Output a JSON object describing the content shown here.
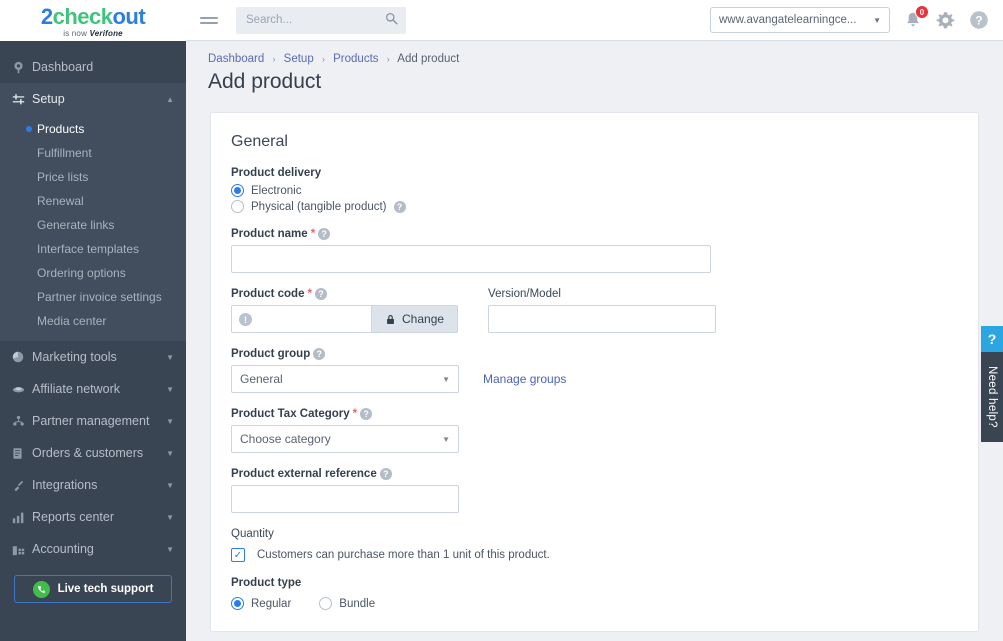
{
  "brand": {
    "logo_part1": "2",
    "logo_part2": "check",
    "logo_part3": "out",
    "tagline_pre": "is now ",
    "tagline_brand": "Verifone",
    "accent_blue": "#2b7de9",
    "accent_green": "#3fc47c",
    "sidebar_bg": "#3a4553"
  },
  "topbar": {
    "menu_icon": "hamburger-icon",
    "search": {
      "value": "",
      "placeholder": "Search..."
    },
    "site_selector": {
      "value": "www.avangatelearningce...",
      "caret": "▼"
    },
    "notifications": {
      "icon": "bell-icon",
      "badge": "0"
    },
    "settings": {
      "icon": "gear-icon"
    },
    "help": {
      "icon": "question-circle-icon"
    }
  },
  "breadcrumb": {
    "items": [
      "Dashboard",
      "Setup",
      "Products",
      "Add product"
    ],
    "separator": "›"
  },
  "page": {
    "title": "Add product"
  },
  "sidebar": {
    "items": [
      {
        "label": "Dashboard",
        "icon": "dashboard-icon",
        "glyph": "◑",
        "expandable": false
      },
      {
        "label": "Setup",
        "icon": "setup-sliders-icon",
        "glyph": "≡",
        "expandable": true,
        "expanded": true,
        "caret": "▲"
      },
      {
        "label": "Marketing tools",
        "icon": "marketing-pie-icon",
        "glyph": "◔",
        "expandable": true,
        "caret": "▼"
      },
      {
        "label": "Affiliate network",
        "icon": "affiliate-icon",
        "glyph": "▬",
        "expandable": true,
        "caret": "▼"
      },
      {
        "label": "Partner management",
        "icon": "partner-people-icon",
        "glyph": "⚘",
        "expandable": true,
        "caret": "▼"
      },
      {
        "label": "Orders & customers",
        "icon": "orders-clipboard-icon",
        "glyph": "☰",
        "expandable": true,
        "caret": "▼"
      },
      {
        "label": "Integrations",
        "icon": "integrations-plug-icon",
        "glyph": "✂",
        "expandable": true,
        "caret": "▼"
      },
      {
        "label": "Reports center",
        "icon": "reports-bars-icon",
        "glyph": "█",
        "expandable": true,
        "caret": "▼"
      },
      {
        "label": "Accounting",
        "icon": "accounting-icon",
        "glyph": "▓",
        "expandable": true,
        "caret": "▼"
      }
    ],
    "setup_children": [
      {
        "label": "Products",
        "active": true
      },
      {
        "label": "Fulfillment",
        "active": false
      },
      {
        "label": "Price lists",
        "active": false
      },
      {
        "label": "Renewal",
        "active": false
      },
      {
        "label": "Generate links",
        "active": false
      },
      {
        "label": "Interface templates",
        "active": false
      },
      {
        "label": "Ordering options",
        "active": false
      },
      {
        "label": "Partner invoice settings",
        "active": false
      },
      {
        "label": "Media center",
        "active": false
      }
    ],
    "support_button": {
      "label": "Live tech support",
      "icon": "phone-support-icon",
      "glyph": "✆"
    }
  },
  "form": {
    "section_title": "General",
    "product_delivery": {
      "label": "Product delivery",
      "options": [
        {
          "label": "Electronic",
          "selected": true,
          "has_help": false
        },
        {
          "label": "Physical (tangible product)",
          "selected": false,
          "has_help": true
        }
      ]
    },
    "product_name": {
      "label": "Product name",
      "required": true,
      "has_help": true,
      "value": "",
      "placeholder": ""
    },
    "product_code": {
      "label": "Product code",
      "required": true,
      "has_help": true,
      "value": "",
      "placeholder": "",
      "info_icon": "exclamation-info-icon",
      "change_button": {
        "label": "Change",
        "icon": "lock-icon",
        "glyph": "🔒"
      }
    },
    "version_model": {
      "label": "Version/Model",
      "required": false,
      "has_help": false,
      "value": "",
      "placeholder": ""
    },
    "product_group": {
      "label": "Product group",
      "required": false,
      "has_help": true,
      "value": "General",
      "options": [
        "General"
      ],
      "manage_link": "Manage groups"
    },
    "product_tax_category": {
      "label": "Product Tax Category",
      "required": true,
      "has_help": true,
      "value": "Choose category",
      "options": [
        "Choose category"
      ]
    },
    "product_external_reference": {
      "label": "Product external reference",
      "required": false,
      "has_help": true,
      "value": "",
      "placeholder": ""
    },
    "quantity": {
      "label": "Quantity",
      "checkbox": {
        "label": "Customers can purchase more than 1 unit of this product.",
        "checked": true,
        "glyph": "✓"
      }
    },
    "product_type": {
      "label": "Product type",
      "options": [
        {
          "label": "Regular",
          "selected": true
        },
        {
          "label": "Bundle",
          "selected": false
        }
      ]
    }
  },
  "help_tab": {
    "mark": "?",
    "label": "Need help?"
  }
}
